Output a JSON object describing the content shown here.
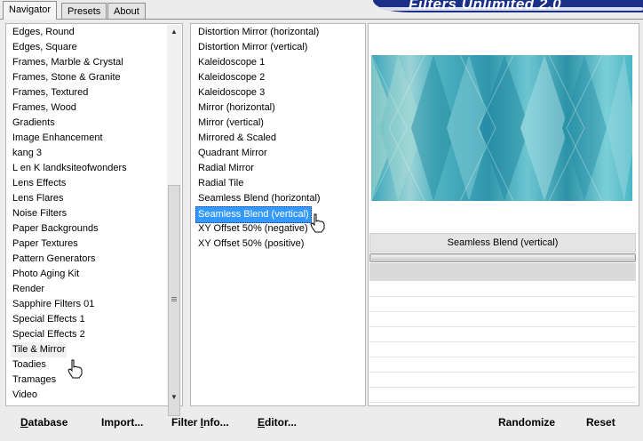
{
  "tabs": [
    {
      "label": "Navigator",
      "active": true
    },
    {
      "label": "Presets",
      "active": false
    },
    {
      "label": "About",
      "active": false
    }
  ],
  "banner_title": "Filters Unlimited 2.0",
  "categories": [
    "Edges, Round",
    "Edges, Square",
    "Frames, Marble & Crystal",
    "Frames, Stone & Granite",
    "Frames, Textured",
    "Frames, Wood",
    "Gradients",
    "Image Enhancement",
    "kang 3",
    "L en K landksiteofwonders",
    "Lens Effects",
    "Lens Flares",
    "Noise Filters",
    "Paper Backgrounds",
    "Paper Textures",
    "Pattern Generators",
    "Photo Aging Kit",
    "Render",
    "Sapphire Filters 01",
    "Special Effects 1",
    "Special Effects 2",
    "Tile & Mirror",
    "Toadies",
    "Tramages",
    "Video"
  ],
  "selected_category": "Tile & Mirror",
  "filters": [
    "Distortion Mirror (horizontal)",
    "Distortion Mirror (vertical)",
    "Kaleidoscope 1",
    "Kaleidoscope 2",
    "Kaleidoscope 3",
    "Mirror (horizontal)",
    "Mirror (vertical)",
    "Mirrored & Scaled",
    "Quadrant Mirror",
    "Radial Mirror",
    "Radial Tile",
    "Seamless Blend (horizontal)",
    "Seamless Blend (vertical)",
    "XY Offset 50% (negative)",
    "XY Offset 50% (positive)"
  ],
  "selected_filter": "Seamless Blend (vertical)",
  "filter_name_display": "Seamless Blend (vertical)",
  "bottom_left": {
    "database": {
      "ul": "D",
      "rest": "atabase"
    },
    "import": {
      "pre": "Import",
      "ul": "",
      "rest": "..."
    },
    "filter_info": {
      "pre": "Filter ",
      "ul": "I",
      "rest": "nfo..."
    },
    "editor": {
      "pre": "",
      "ul": "E",
      "rest": "ditor..."
    }
  },
  "bottom_right": {
    "randomize": "Randomize",
    "reset": "Reset"
  },
  "colors": {
    "selection": "#3399ff",
    "banner": "#1a2f86",
    "preview_base": "#4fb3c2"
  },
  "icons": {
    "cursor": "hand-pointer-icon",
    "scroll_up": "arrow-up-icon",
    "scroll_down": "arrow-down-icon"
  }
}
